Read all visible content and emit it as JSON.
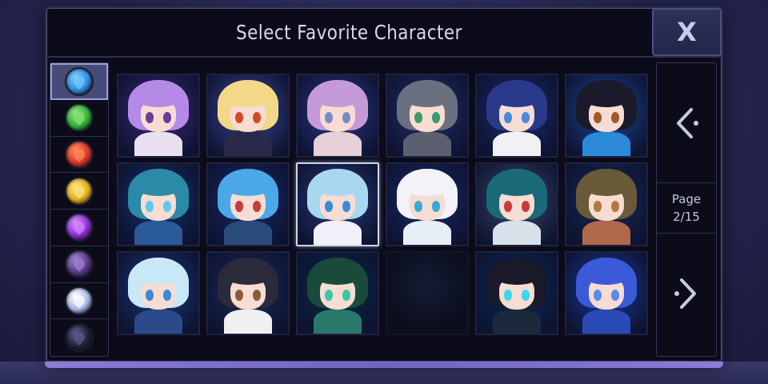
{
  "dialog": {
    "title": "Select Favorite Character",
    "close_label": "X"
  },
  "element_tabs": [
    {
      "name": "water",
      "color": "#2f8fe0",
      "glow": "#7cc8ff",
      "selected": true
    },
    {
      "name": "nature",
      "color": "#2fb33a",
      "glow": "#8fe07a",
      "selected": false
    },
    {
      "name": "fire",
      "color": "#d9382a",
      "glow": "#ff8a5a",
      "selected": false
    },
    {
      "name": "light",
      "color": "#e0b020",
      "glow": "#ffe27a",
      "selected": false
    },
    {
      "name": "arcane",
      "color": "#8a2fd0",
      "glow": "#d28aff",
      "selected": false
    },
    {
      "name": "shadow",
      "color": "#5a3a8a",
      "glow": "#a080d0",
      "selected": false
    },
    {
      "name": "spirit",
      "color": "#a8b8e8",
      "glow": "#ffffff",
      "selected": false
    },
    {
      "name": "void",
      "color": "#22223a",
      "glow": "#5a5a8a",
      "selected": false
    }
  ],
  "characters": [
    {
      "hair": "#b48ae6",
      "bg": "#3a2a7a",
      "eye": "#6b3a9a",
      "body": "#e8e0f0",
      "selected": false,
      "empty": false
    },
    {
      "hair": "#f3d88a",
      "bg": "#3a4a9a",
      "eye": "#d04a2a",
      "body": "#2a2a4a",
      "selected": false,
      "empty": false
    },
    {
      "hair": "#c69ad8",
      "bg": "#2a3a8a",
      "eye": "#7a8ac8",
      "body": "#e8d0d8",
      "selected": false,
      "empty": false
    },
    {
      "hair": "#6a7080",
      "bg": "#22306a",
      "eye": "#3a9a6a",
      "body": "#5a6070",
      "selected": false,
      "empty": false
    },
    {
      "hair": "#2a3a8a",
      "bg": "#1e2a6a",
      "eye": "#4a8ad8",
      "body": "#f0f0f5",
      "selected": false,
      "empty": false
    },
    {
      "hair": "#1a1a2a",
      "bg": "#1a4a9a",
      "eye": "#a05a2a",
      "body": "#2a8ad8",
      "selected": false,
      "empty": false
    },
    {
      "hair": "#2a8aa8",
      "bg": "#14306a",
      "eye": "#5acaf0",
      "body": "#2a5a9a",
      "selected": false,
      "empty": false
    },
    {
      "hair": "#4aa8e8",
      "bg": "#1a2a6a",
      "eye": "#c83a3a",
      "body": "#2a4a7a",
      "selected": false,
      "empty": false
    },
    {
      "hair": "#a8d8f0",
      "bg": "#2a3a7a",
      "eye": "#3a8ad8",
      "body": "#f0f0f8",
      "selected": true,
      "empty": false
    },
    {
      "hair": "#f2f2f8",
      "bg": "#1a2a6a",
      "eye": "#3aa8d8",
      "body": "#e8eef8",
      "selected": false,
      "empty": false
    },
    {
      "hair": "#1a6a7a",
      "bg": "#3a4a6a",
      "eye": "#c83a3a",
      "body": "#d8e0ea",
      "selected": false,
      "empty": false
    },
    {
      "hair": "#6a5a3a",
      "bg": "#1a2a5a",
      "eye": "#b07a3a",
      "body": "#b06a4a",
      "selected": false,
      "empty": false
    },
    {
      "hair": "#c8e8f8",
      "bg": "#1a3a7a",
      "eye": "#3a8ad8",
      "body": "#2a4a8a",
      "selected": false,
      "empty": false
    },
    {
      "hair": "#2a2a3a",
      "bg": "#1a2a5a",
      "eye": "#8a5a3a",
      "body": "#f0f0f0",
      "selected": false,
      "empty": false
    },
    {
      "hair": "#1a4a3a",
      "bg": "#0a2a4a",
      "eye": "#3ac8a8",
      "body": "#2a7a6a",
      "selected": false,
      "empty": false
    },
    {
      "hair": "",
      "bg": "",
      "eye": "",
      "body": "",
      "selected": false,
      "empty": true
    },
    {
      "hair": "#1a1a2a",
      "bg": "#0a2a5a",
      "eye": "#3ad8f0",
      "body": "#1a2a3a",
      "selected": false,
      "empty": false
    },
    {
      "hair": "#3a5ad8",
      "bg": "#1a3a9a",
      "eye": "#5a8af0",
      "body": "#2a4ab8",
      "selected": false,
      "empty": false
    }
  ],
  "pagination": {
    "label": "Page",
    "value": "2/15",
    "prev_glyph": "<·",
    "next_glyph": "·>"
  }
}
